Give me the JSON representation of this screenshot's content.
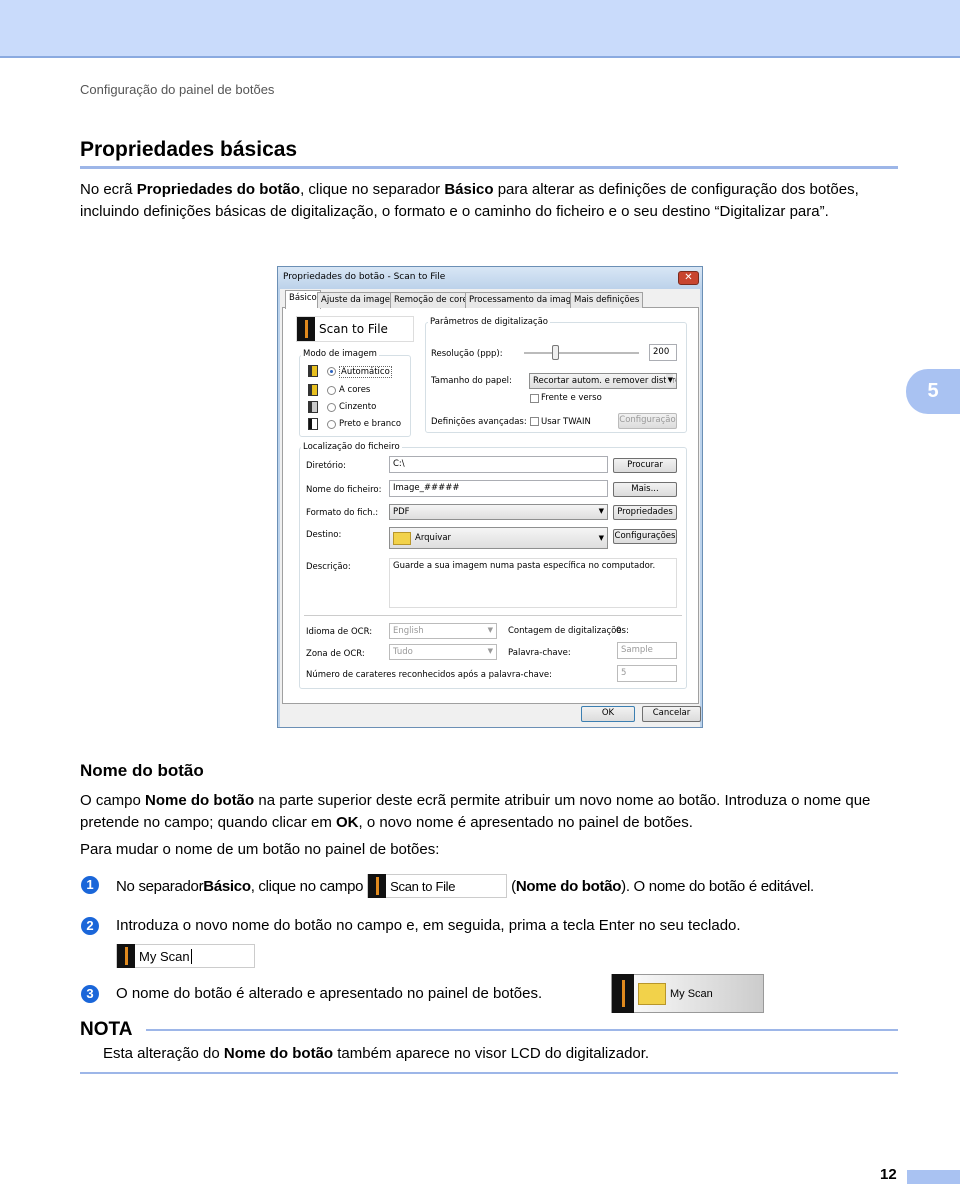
{
  "header": {
    "running_title": "Configuração do painel de botões",
    "chapter": "5",
    "page_number": "12"
  },
  "section": {
    "title": "Propriedades básicas",
    "intro": [
      "No ecrã ",
      "Propriedades do botão",
      ", clique no separador ",
      "Básico",
      " para alterar as definições de configuração dos botões, incluindo definições básicas de digitalização, o formato e o caminho do ficheiro e o seu destino “Digitalizar para”."
    ]
  },
  "dialog": {
    "title": "Propriedades do botão - Scan to File",
    "close_label": "✕",
    "tabs": [
      "Básico",
      "Ajuste da imagem",
      "Remoção de cores",
      "Processamento da imagem",
      "Mais definições"
    ],
    "button_name": "Scan to File",
    "image_mode": {
      "label": "Modo de imagem",
      "options": [
        "Automático",
        "A cores",
        "Cinzento",
        "Preto e branco"
      ],
      "selected": "Automático"
    },
    "scan_params": {
      "label": "Parâmetros de digitalização",
      "resolution_label": "Resolução (ppp):",
      "resolution": "200",
      "paper_label": "Tamanho do papel:",
      "paper": "Recortar autom. e remover distorçã",
      "duplex": "Frente e verso",
      "advanced_label": "Definições avançadas:",
      "twain": "Usar TWAIN",
      "config_button": "Configuração"
    },
    "file_location": {
      "label": "Localização do ficheiro",
      "dir_label": "Diretório:",
      "dir": "C:\\",
      "browse": "Procurar",
      "name_label": "Nome do ficheiro:",
      "name": "Image_#####",
      "more": "Mais...",
      "format_label": "Formato do fich.:",
      "format": "PDF",
      "properties": "Propriedades",
      "dest_label": "Destino:",
      "dest": "Arquivar",
      "settings": "Configurações",
      "desc_label": "Descrição:",
      "desc": "Guarde a sua imagem numa pasta específica no computador."
    },
    "ocr": {
      "lang_label": "Idioma de OCR:",
      "lang": "English",
      "zone_label": "Zona de OCR:",
      "zone": "Tudo",
      "count_label": "Contagem de digitalizações:",
      "count": "0",
      "keyword_label": "Palavra-chave:",
      "keyword": "Sample",
      "chars_label": "Número de carateres reconhecidos após a palavra-chave:",
      "chars": "5"
    },
    "ok": "OK",
    "cancel": "Cancelar"
  },
  "button_name_section": {
    "title": "Nome do botão",
    "p1": [
      "O campo ",
      "Nome do botão",
      " na parte superior deste ecrã permite atribuir um novo nome ao botão. Introduza o nome que pretende no campo; quando clicar em ",
      "OK",
      ", o novo nome é apresentado no painel de botões."
    ],
    "p2": "Para mudar o nome de um botão no painel de botões:",
    "steps": [
      {
        "num": "1",
        "a": "No separador ",
        "b": "Básico",
        ", c": "",
        "c": ", clique no campo ",
        "field": "Scan to File",
        "d": "(",
        "e": "Nome do botão",
        "f": "). O nome do botão é editável."
      },
      {
        "num": "2",
        "text": "Introduza o novo nome do botão no campo e, em seguida, prima a tecla Enter no seu teclado.",
        "field": "My Scan"
      },
      {
        "num": "3",
        "text": "O nome do botão é alterado e apresentado no painel de botões.",
        "panel_button": "My Scan"
      }
    ]
  },
  "note": {
    "title": "NOTA",
    "text": [
      "Esta alteração do ",
      "Nome do botão",
      " também aparece no visor LCD do digitalizador."
    ]
  }
}
